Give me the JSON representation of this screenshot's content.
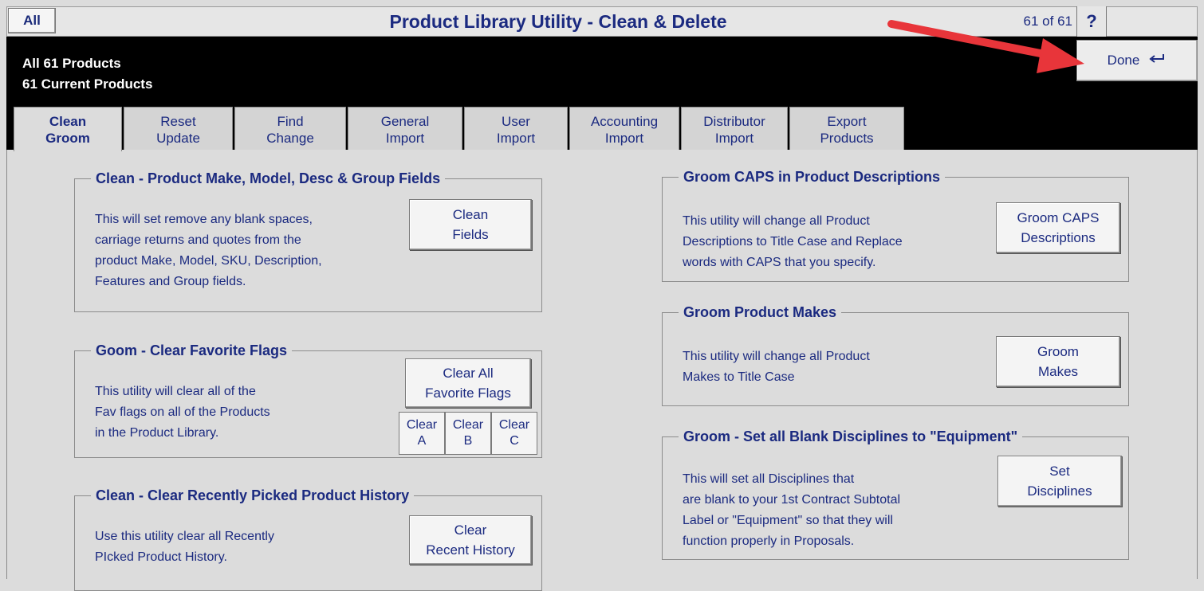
{
  "titlebar": {
    "all_label": "All",
    "title": "Product Library Utility - Clean & Delete",
    "record_count": "61 of 61",
    "help_label": "?"
  },
  "header": {
    "line1": "All 61 Products",
    "line2": "61 Current Products",
    "done_label": "Done",
    "done_icon": "return-arrow-icon"
  },
  "tabs": [
    {
      "label": "Clean\nGroom",
      "active": true
    },
    {
      "label": "Reset\nUpdate"
    },
    {
      "label": "Find\nChange"
    },
    {
      "label": "General\nImport"
    },
    {
      "label": "User\nImport"
    },
    {
      "label": "Accounting\nImport"
    },
    {
      "label": "Distributor\nImport"
    },
    {
      "label": "Export\nProducts"
    }
  ],
  "groups": {
    "clean_fields": {
      "title": "Clean - Product Make, Model, Desc & Group Fields",
      "desc": "This will set remove any blank spaces,\ncarriage returns and quotes from the\nproduct Make, Model, SKU, Description,\nFeatures and Group fields.",
      "button": "Clean\nFields"
    },
    "favorite_flags": {
      "title": "Goom - Clear Favorite Flags",
      "desc": "This utility will clear all of the\nFav flags on all of the Products\nin the Product Library.",
      "button": "Clear All\nFavorite Flags",
      "clear_a": "Clear\nA",
      "clear_b": "Clear\nB",
      "clear_c": "Clear\nC"
    },
    "recent_history": {
      "title": "Clean - Clear Recently Picked Product History",
      "desc": "Use this utility clear all Recently\nPIcked Product History.",
      "button": "Clear\nRecent History"
    },
    "groom_caps": {
      "title": "Groom CAPS in Product Descriptions",
      "desc": "This utility will change all Product\nDescriptions to Title Case and Replace\nwords with CAPS that you specify.",
      "button": "Groom CAPS\nDescriptions"
    },
    "groom_makes": {
      "title": "Groom Product Makes",
      "desc": "This utility will change all Product\nMakes to Title Case",
      "button": "Groom\nMakes"
    },
    "disciplines": {
      "title": "Groom - Set all Blank Disciplines to \"Equipment\"",
      "desc": "This will set all Disciplines that\nare blank to your 1st Contract Subtotal\nLabel or \"Equipment\" so that they will\nfunction properly in Proposals.",
      "button": "Set\nDisciplines"
    }
  },
  "colors": {
    "text_blue": "#1b2a80",
    "header_bg": "#000000",
    "panel_bg": "#dcdcdc",
    "arrow_red": "#e8353a"
  }
}
